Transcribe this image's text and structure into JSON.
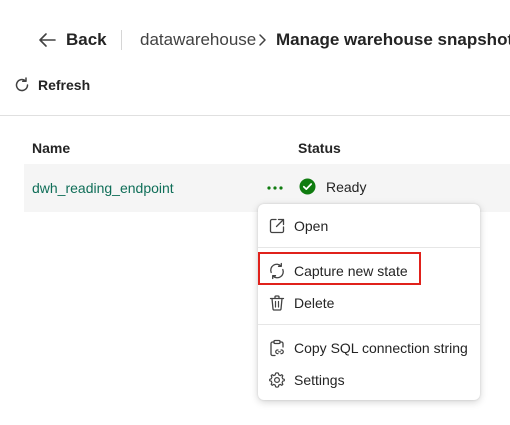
{
  "header": {
    "back_label": "Back",
    "breadcrumb": "datawarehouse",
    "title": "Manage warehouse snapshot"
  },
  "toolbar": {
    "refresh_label": "Refresh"
  },
  "table": {
    "columns": [
      "Name",
      "Status"
    ],
    "rows": [
      {
        "name": "dwh_reading_endpoint",
        "status": "Ready"
      }
    ]
  },
  "context_menu": {
    "items": [
      {
        "label": "Open",
        "icon": "open-in-new-icon"
      },
      {
        "label": "Capture new state",
        "icon": "sync-icon"
      },
      {
        "label": "Delete",
        "icon": "trash-icon"
      },
      {
        "label": "Copy SQL connection string",
        "icon": "clipboard-link-icon"
      },
      {
        "label": "Settings",
        "icon": "gear-icon"
      }
    ]
  },
  "colors": {
    "link": "#0f6e58",
    "status_ready": "#107c10",
    "highlight": "#e0211b"
  }
}
